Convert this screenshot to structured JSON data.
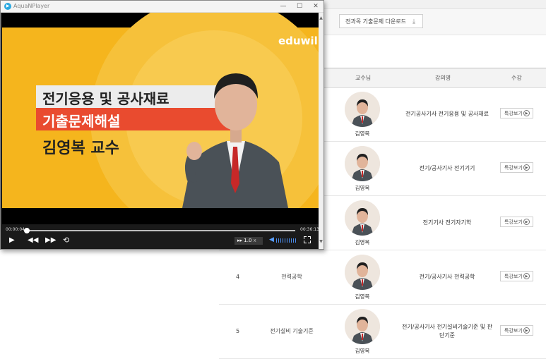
{
  "window": {
    "title": "AquaNPlayer",
    "minimize": "—",
    "maximize": "☐",
    "close": "✕"
  },
  "download_button": {
    "label": "전과목 기출문제 다운로드",
    "icon": "download-icon"
  },
  "table": {
    "headers": {
      "professor": "교수님",
      "lecture": "강의명",
      "watch": "수강"
    },
    "rows": [
      {
        "no": "",
        "subject": "",
        "professor": "김영복",
        "lecture": "전기공사기사 전기응용 및 공사재료",
        "watch": "특강보기"
      },
      {
        "no": "",
        "subject": "",
        "professor": "김영복",
        "lecture": "전기/공사기사 전기기기",
        "watch": "특강보기"
      },
      {
        "no": "",
        "subject": "",
        "professor": "김영복",
        "lecture": "전기기사 전기자기학",
        "watch": "특강보기"
      },
      {
        "no": "4",
        "subject": "전력공학",
        "professor": "김영복",
        "lecture": "전기/공사기사 전력공학",
        "watch": "특강보기"
      },
      {
        "no": "5",
        "subject": "전기설비 기술기준",
        "professor": "김영복",
        "lecture": "전기/공사기사 전기설비기술기준 및 판단기준",
        "watch": "특강보기"
      }
    ]
  },
  "video": {
    "brand": "eduwill",
    "title_line1": "전기응용 및 공사재료",
    "title_line2": "기출문제해설",
    "title_line3": "김영복 교수",
    "bg_color": "#f5b51d",
    "accent_color": "#e94b2f"
  },
  "player": {
    "current_time": "00:00:04",
    "total_time": "00:36:13",
    "progress": 0.002,
    "speed": "1.0",
    "speed_unit": "x",
    "volume": 1.0
  }
}
